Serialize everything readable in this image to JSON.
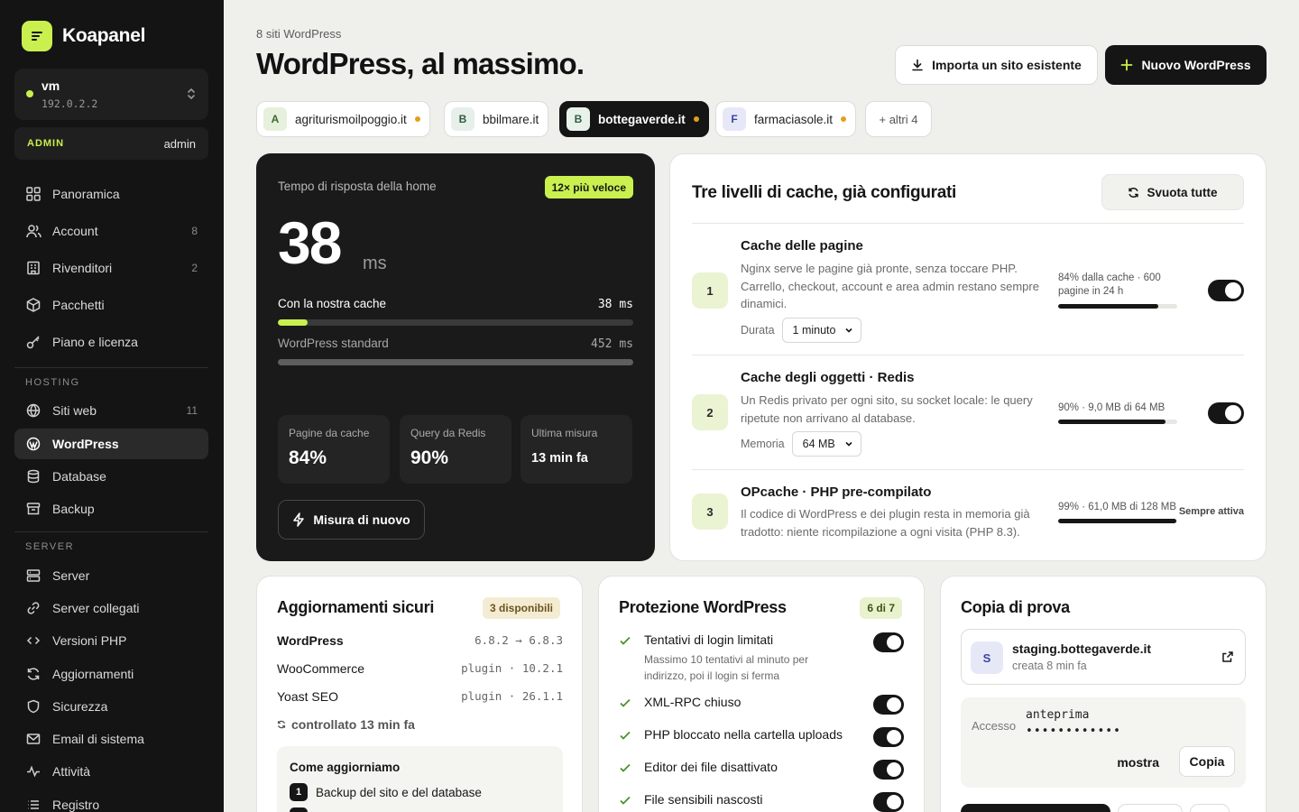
{
  "brand": {
    "name": "Koapanel"
  },
  "server": {
    "name": "vm",
    "ip": "192.0.2.2"
  },
  "role": {
    "badge": "ADMIN",
    "user": "admin"
  },
  "nav": {
    "main": [
      {
        "label": "Panoramica",
        "icon": "grid-icon",
        "count": ""
      },
      {
        "label": "Account",
        "icon": "users-icon",
        "count": "8"
      },
      {
        "label": "Rivenditori",
        "icon": "building-icon",
        "count": "2"
      },
      {
        "label": "Pacchetti",
        "icon": "package-icon",
        "count": ""
      },
      {
        "label": "Piano e licenza",
        "icon": "key-icon",
        "count": ""
      }
    ],
    "hosting_label": "HOSTING",
    "hosting": [
      {
        "label": "Siti web",
        "icon": "globe-icon",
        "count": "11"
      },
      {
        "label": "WordPress",
        "icon": "wordpress-icon",
        "count": "",
        "active": true
      },
      {
        "label": "Database",
        "icon": "database-icon",
        "count": ""
      },
      {
        "label": "Backup",
        "icon": "archive-icon",
        "count": ""
      }
    ],
    "server_label": "SERVER",
    "server": [
      {
        "label": "Server",
        "icon": "server-icon"
      },
      {
        "label": "Server collegati",
        "icon": "link-icon"
      },
      {
        "label": "Versioni PHP",
        "icon": "code-icon"
      },
      {
        "label": "Aggiornamenti",
        "icon": "refresh-icon"
      },
      {
        "label": "Sicurezza",
        "icon": "shield-icon"
      },
      {
        "label": "Email di sistema",
        "icon": "mail-icon"
      },
      {
        "label": "Attività",
        "icon": "activity-icon"
      },
      {
        "label": "Registro",
        "icon": "list-icon"
      }
    ]
  },
  "header": {
    "count": "8 siti WordPress",
    "title": "WordPress, al massimo.",
    "import_label": "Importa un sito esistente",
    "new_label": "Nuovo WordPress"
  },
  "sites": [
    {
      "letter": "A",
      "name": "agriturismoilpoggio.it",
      "dot": true,
      "color": "#e6f0dc",
      "text": "#3c6a2a"
    },
    {
      "letter": "B",
      "name": "bbilmare.it",
      "dot": false,
      "color": "#e6efe9",
      "text": "#2f5d45"
    },
    {
      "letter": "B",
      "name": "bottegaverde.it",
      "dot": true,
      "active": true,
      "color": "#e8f2ea",
      "text": "#2f5d45"
    },
    {
      "letter": "F",
      "name": "farmaciasole.it",
      "dot": true,
      "color": "#e7e8f7",
      "text": "#3b44a6"
    }
  ],
  "sites_more": "+ altri 4",
  "perf": {
    "label": "Tempo di risposta della home",
    "badge": "12× più veloce",
    "value": "38",
    "unit": "ms",
    "ours_label": "Con la nostra cache",
    "ours_value": "38 ms",
    "ours_ms": 38,
    "std_label": "WordPress standard",
    "std_value": "452 ms",
    "std_ms": 452,
    "stats": [
      {
        "label": "Pagine da cache",
        "value": "84%"
      },
      {
        "label": "Query da Redis",
        "value": "90%"
      },
      {
        "label": "Ultima misura",
        "value": "13 min fa"
      }
    ],
    "button": "Misura di nuovo"
  },
  "cache": {
    "title": "Tre livelli di cache, già configurati",
    "flush": "Svuota tutte",
    "levels": [
      {
        "num": "1",
        "title": "Cache delle pagine",
        "desc": "Nginx serve le pagine già pronte, senza toccare PHP. Carrello, checkout, account e area admin restano sempre dinamici.",
        "meta_label": "Durata",
        "meta_value": "1 minuto",
        "stat": "84% dalla cache · 600 pagine in 24 h",
        "fill": 0.84
      },
      {
        "num": "2",
        "title": "Cache degli oggetti · Redis",
        "desc": "Un Redis privato per ogni sito, su socket locale: le query ripetute non arrivano al database.",
        "meta_label": "Memoria",
        "meta_value": "64 MB",
        "stat": "90% · 9,0 MB di 64 MB",
        "fill": 0.9
      },
      {
        "num": "3",
        "title": "OPcache · PHP pre-compilato",
        "desc": "Il codice di WordPress e dei plugin resta in memoria già tradotto: niente ricompilazione a ogni visita (PHP 8.3).",
        "stat": "99% · 61,0 MB di 128 MB",
        "always": "Sempre attiva",
        "fill": 0.99
      }
    ]
  },
  "updates": {
    "title": "Aggiornamenti sicuri",
    "badge": "3 disponibili",
    "rows": [
      {
        "name": "WordPress",
        "version": "6.8.2 → 6.8.3"
      },
      {
        "name": "WooCommerce",
        "version": "plugin · 10.2.1"
      },
      {
        "name": "Yoast SEO",
        "version": "plugin · 26.1.1"
      }
    ],
    "checked": "controllato 13 min fa",
    "how_title": "Come aggiorniamo",
    "steps": [
      {
        "n": "1",
        "text": "Backup del sito e del database"
      }
    ]
  },
  "protection": {
    "title": "Protezione WordPress",
    "badge": "6 di 7",
    "rows": [
      {
        "label": "Tentativi di login limitati",
        "sub": "Massimo 10 tentativi al minuto per indirizzo, poi il login si ferma"
      },
      {
        "label": "XML-RPC chiuso",
        "sub": ""
      },
      {
        "label": "PHP bloccato nella cartella uploads",
        "sub": ""
      },
      {
        "label": "Editor dei file disattivato",
        "sub": ""
      },
      {
        "label": "File sensibili nascosti",
        "sub": ""
      }
    ]
  },
  "staging": {
    "title": "Copia di prova",
    "letter": "S",
    "domain": "staging.bottegaverde.it",
    "created": "creata 8 min fa",
    "access_label": "Accesso",
    "user": "anteprima",
    "password": "••••••••••••",
    "show": "mostra",
    "copy": "Copia"
  },
  "colors": {
    "accent": "#c9f04f",
    "dark": "#151515",
    "dot": "#e0a11a"
  }
}
